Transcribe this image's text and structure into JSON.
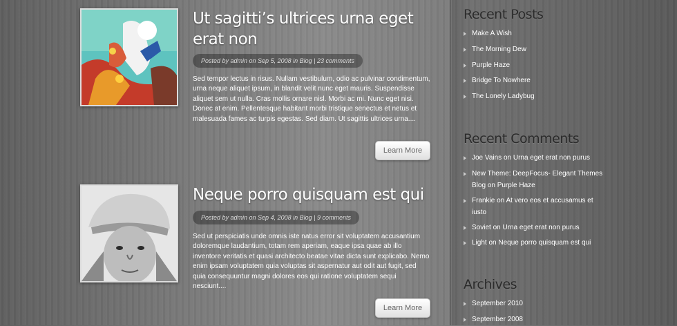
{
  "posts": [
    {
      "title": "Ut sagitti’s ultrices urna eget erat non",
      "meta": "Posted by admin on Sep 5, 2008 in Blog | 23 comments",
      "excerpt": "Sed tempor lectus in risus. Nullam vestibulum, odio ac pulvinar condimentum, urna neque aliquet ipsum, in blandit velit nunc eget mauris. Suspendisse aliquet sem ut nulla. Cras mollis ornare nisl. Morbi ac mi. Nunc eget nisi. Donec at enim. Pellentesque habitant morbi tristique senectus et netus et malesuada fames ac turpis egestas. Sed diam. Ut sagittis ultrices urna....",
      "more_label": "Learn More"
    },
    {
      "title": "Neque porro quisquam est qui",
      "meta": "Posted by admin on Sep 4, 2008 in Blog | 9 comments",
      "excerpt": "Sed ut perspiciatis unde omnis iste natus error sit voluptatem accusantium doloremque laudantium, totam rem aperiam, eaque ipsa quae ab illo inventore veritatis et quasi architecto beatae vitae dicta sunt explicabo. Nemo enim ipsam voluptatem quia voluptas sit aspernatur aut odit aut fugit, sed quia consequuntur magni dolores eos qui ratione voluptatem sequi nesciunt....",
      "more_label": "Learn More"
    }
  ],
  "sidebar": {
    "recent_posts": {
      "title": "Recent Posts",
      "items": [
        "Make A Wish",
        "The Morning Dew",
        "Purple Haze",
        "Bridge To Nowhere",
        "The Lonely Ladybug"
      ]
    },
    "recent_comments": {
      "title": "Recent Comments",
      "items": [
        "Joe Vains on Urna eget erat non purus",
        "New Theme: DeepFocus- Elegant Themes Blog on Purple Haze",
        "Frankie on At vero eos et accusamus et iusto",
        "Soviet on Urna eget erat non purus",
        "Light on Neque porro quisquam est qui"
      ]
    },
    "archives": {
      "title": "Archives",
      "items": [
        "September 2010",
        "September 2008"
      ]
    }
  }
}
